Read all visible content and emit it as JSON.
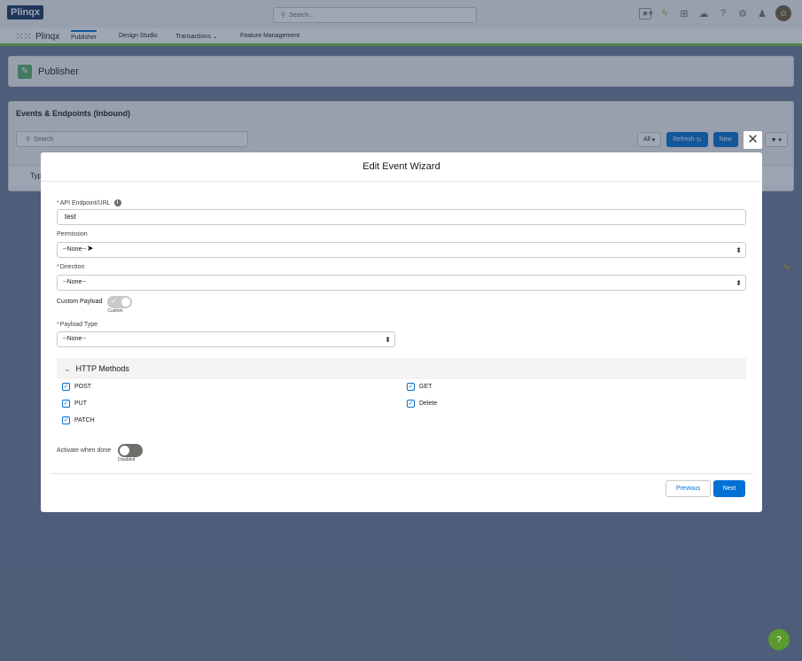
{
  "app": {
    "logo": "Plinqx",
    "name": "Plinqx",
    "search_placeholder": "Search...",
    "tabs": [
      "Publisher",
      "Design Studio",
      "Transactions",
      "Feature Management"
    ],
    "transactions_chevron": "⌄"
  },
  "page": {
    "title": "Publisher"
  },
  "list": {
    "title": "Events & Endpoints (Inbound)",
    "search_placeholder": "Search",
    "filter_all": "All",
    "refresh": "Refresh",
    "new": "New",
    "column_partial": "Typ"
  },
  "modal": {
    "title": "Edit Event Wizard",
    "close": "✕",
    "api_endpoint_label": "API Endpoint/URL",
    "api_endpoint_value": "test",
    "permission_label": "Permission",
    "permission_value": "--None--",
    "direction_label": "Direction",
    "direction_value": "--None--",
    "custom_payload_label": "Custom Payload",
    "custom_payload_caption": "Custom",
    "payload_type_label": "Payload Type",
    "payload_type_value": "--None--",
    "http_section_title": "HTTP Methods",
    "methods": [
      {
        "label": "POST",
        "checked": true
      },
      {
        "label": "GET",
        "checked": true
      },
      {
        "label": "PUT",
        "checked": true
      },
      {
        "label": "Delete",
        "checked": true
      },
      {
        "label": "PATCH",
        "checked": true
      }
    ],
    "activate_label": "Activate when done",
    "activate_caption": "Disabled",
    "previous": "Previous",
    "next": "Next"
  },
  "help": "?",
  "colors": {
    "brand": "#0070d2",
    "accent_green": "#6cbf3b",
    "overlay": "#2b3a58"
  }
}
